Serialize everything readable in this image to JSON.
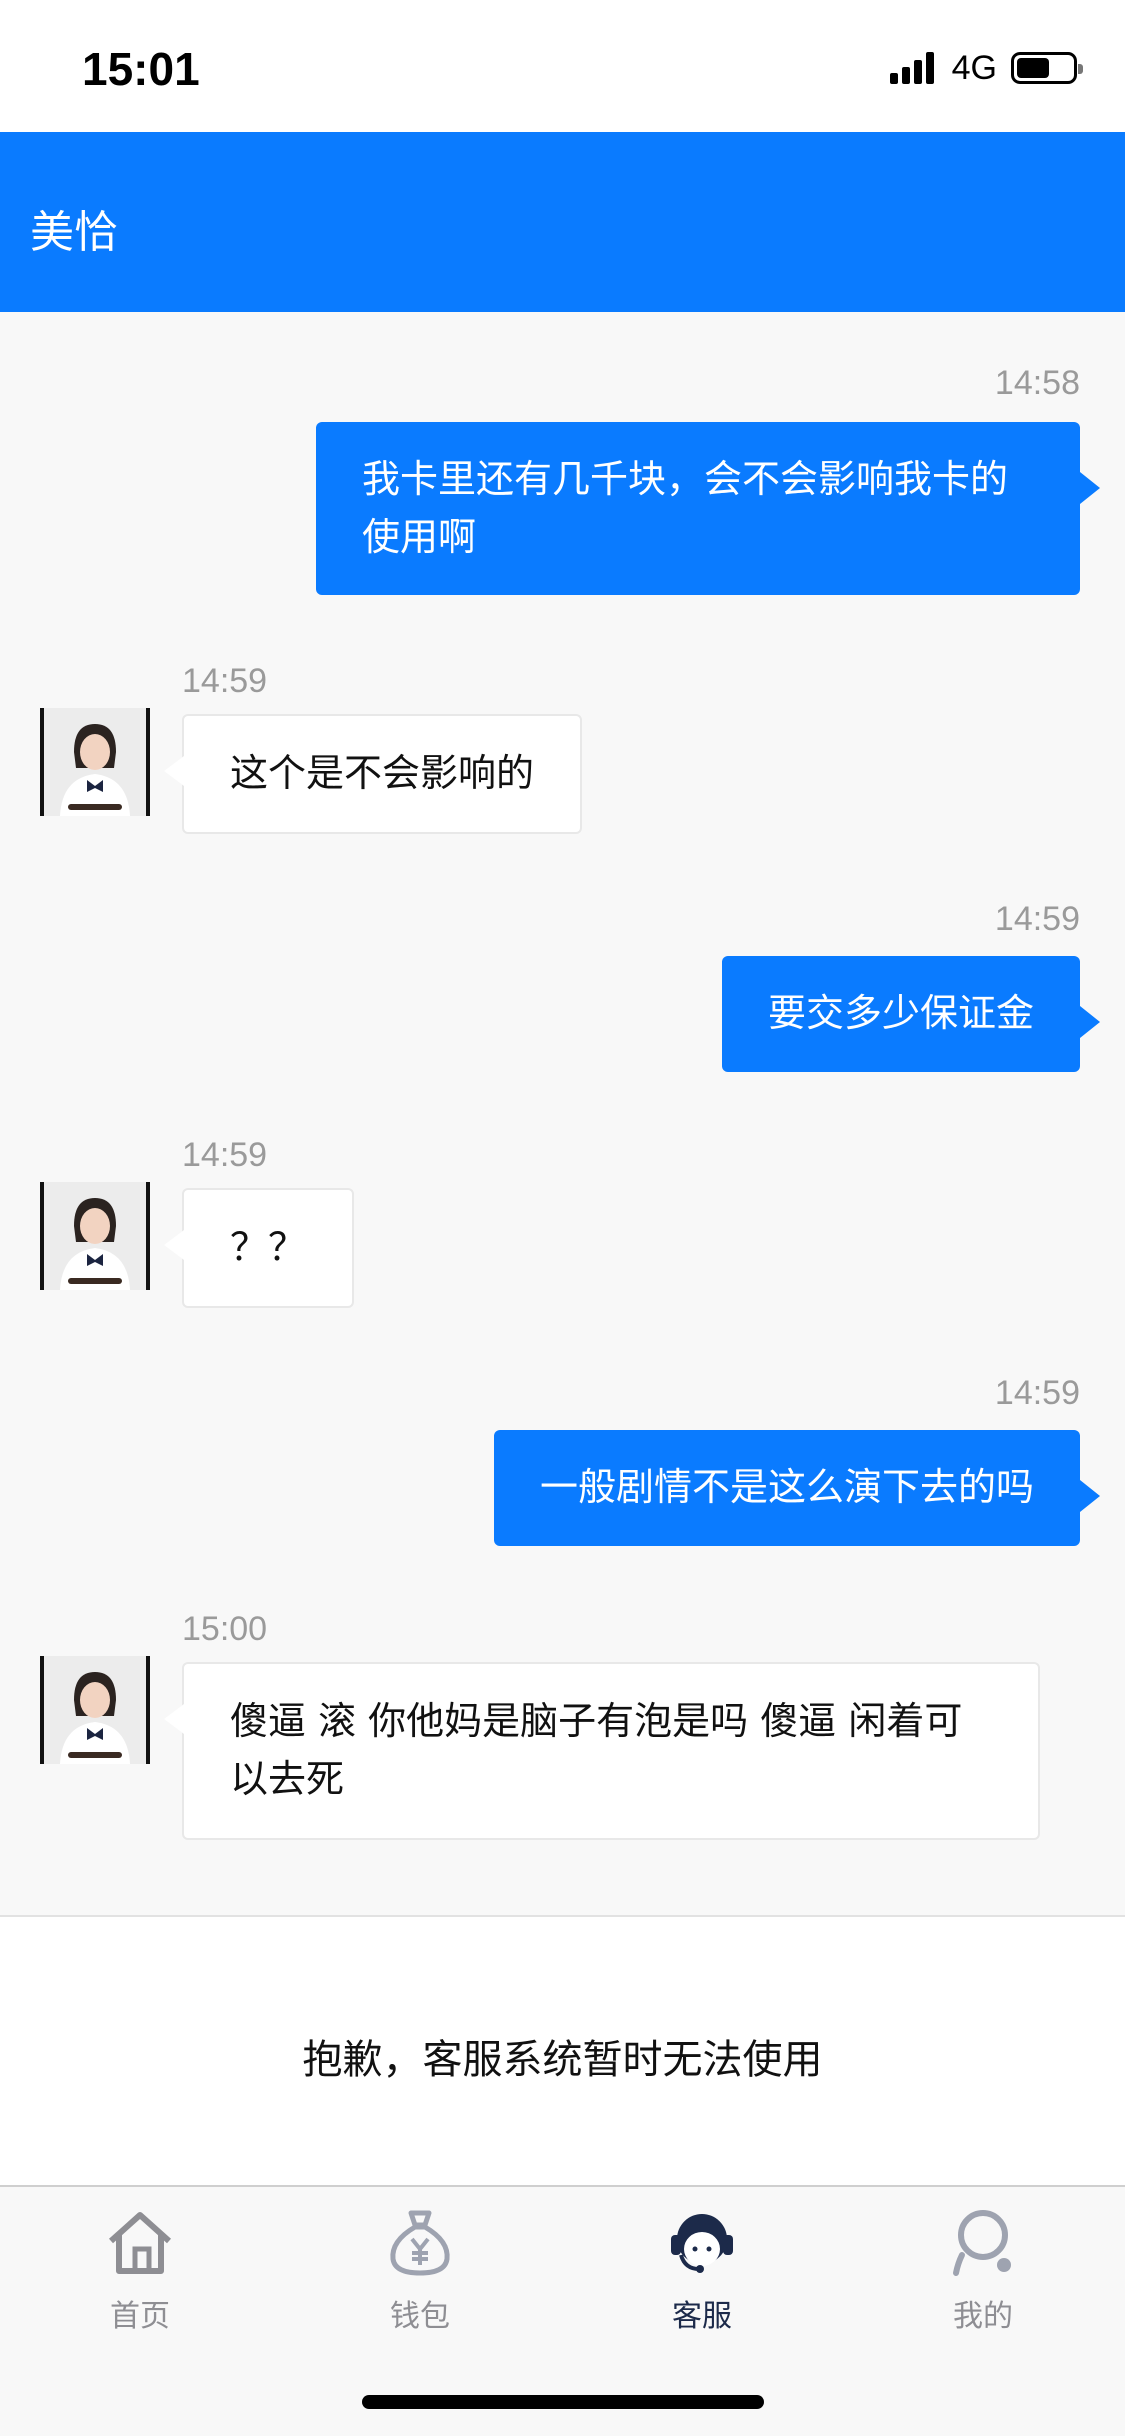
{
  "status_bar": {
    "time": "15:01",
    "network": "4G",
    "battery_level": 0.55
  },
  "header": {
    "title": "美恰"
  },
  "messages": [
    {
      "direction": "out",
      "time": "14:58",
      "text": "我卡里还有几千块，会不会影响我卡的使用啊"
    },
    {
      "direction": "in",
      "time": "14:59",
      "text": "这个是不会影响的"
    },
    {
      "direction": "out",
      "time": "14:59",
      "text": "要交多少保证金"
    },
    {
      "direction": "in",
      "time": "14:59",
      "text": "？？"
    },
    {
      "direction": "out",
      "time": "14:59",
      "text": "一般剧情不是这么演下去的吗"
    },
    {
      "direction": "in",
      "time": "15:00",
      "text": "傻逼 滚 你他妈是脑子有泡是吗 傻逼 闲着可以去死"
    }
  ],
  "notice": {
    "text": "抱歉，客服系统暂时无法使用"
  },
  "tabbar": {
    "items": [
      {
        "label": "首页",
        "icon": "home-icon",
        "active": false
      },
      {
        "label": "钱包",
        "icon": "money-bag-icon",
        "active": false
      },
      {
        "label": "客服",
        "icon": "customer-service-icon",
        "active": true
      },
      {
        "label": "我的",
        "icon": "person-icon",
        "active": false
      }
    ]
  },
  "colors": {
    "accent": "#0a7bff",
    "inactive": "#8e8e93",
    "active": "#1c2a4a"
  }
}
